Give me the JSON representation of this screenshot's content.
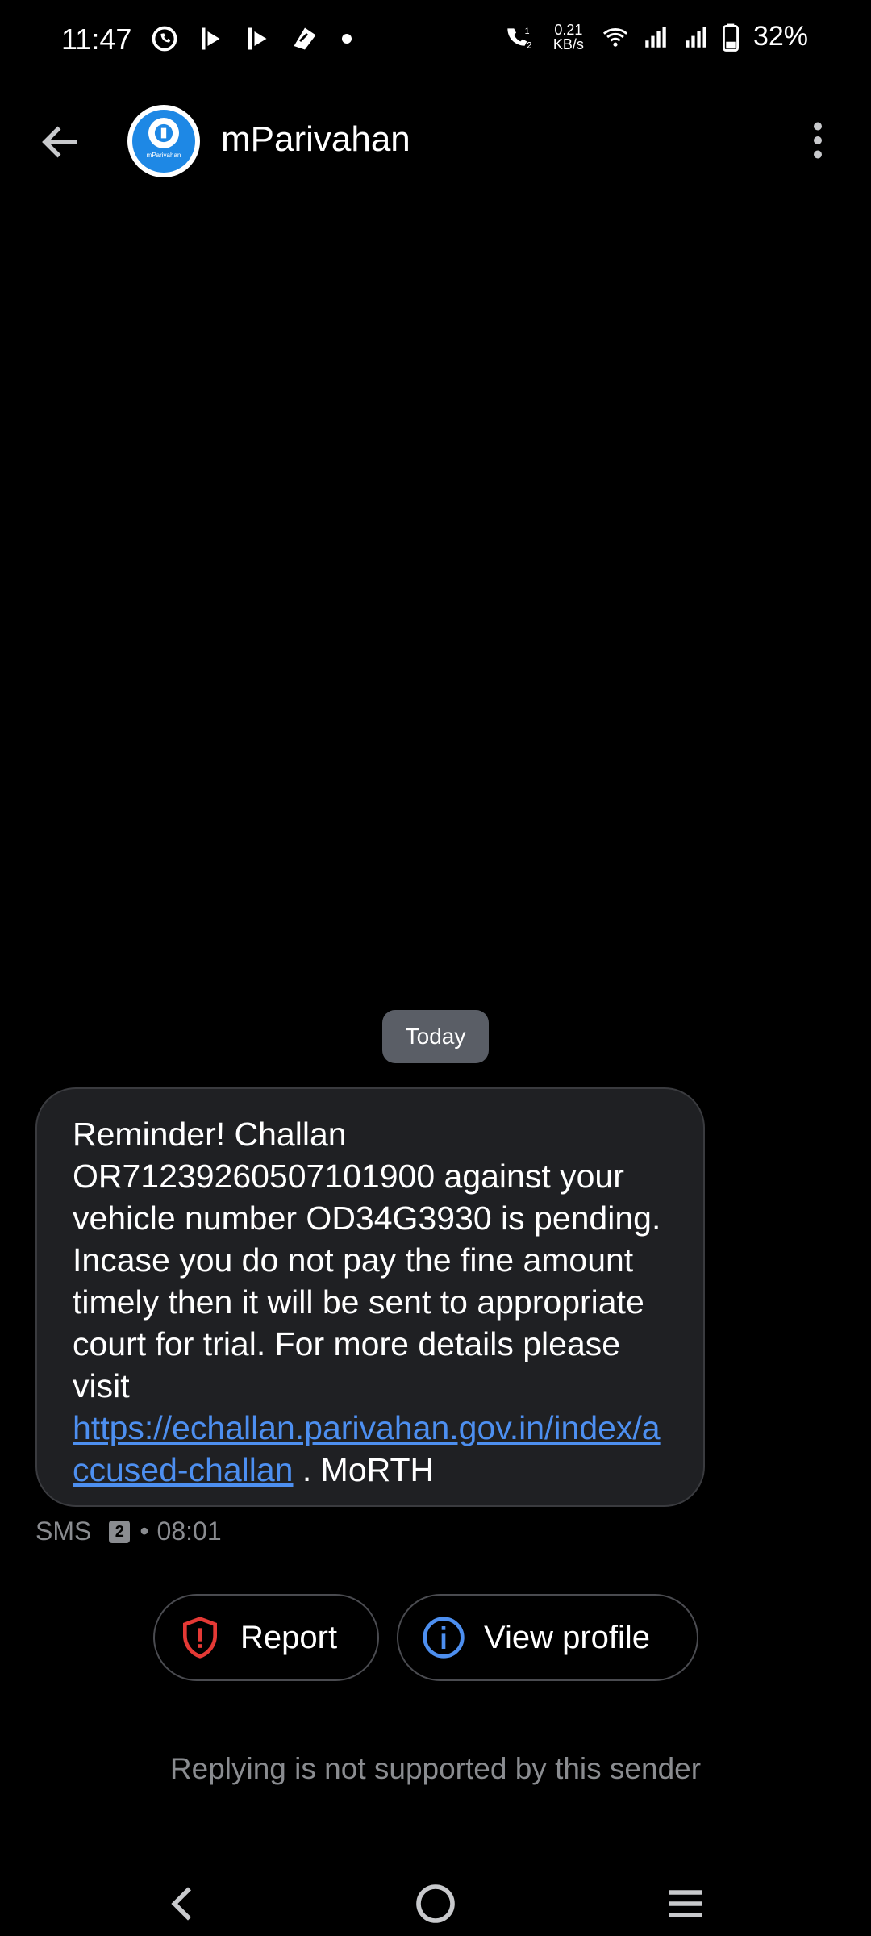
{
  "status_bar": {
    "time": "11:47",
    "net_speed_value": "0.21",
    "net_speed_unit": "KB/s",
    "battery_percent": "32%",
    "icons": [
      "whatsapp-icon",
      "media-icon",
      "media-icon",
      "app-icon",
      "dot",
      "call-icon",
      "wifi-icon",
      "signal-icon",
      "signal-icon",
      "battery-icon"
    ]
  },
  "header": {
    "contact_name": "mParivahan",
    "avatar_text": "mParivahan"
  },
  "conversation": {
    "date_chip": "Today",
    "message": {
      "text": "Reminder! Challan OR71239260507101900 against your vehicle number OD34G3930 is pending. Incase you do not pay the fine amount timely then it will be sent to appropriate court for trial. For more details please visit ",
      "link": "https://echallan.parivahan.gov.in/index/accused-challan",
      "suffix": " . MoRTH"
    },
    "meta": {
      "type": "SMS",
      "sim": "2",
      "separator": "•",
      "time": "08:01"
    }
  },
  "actions": {
    "report_label": "Report",
    "view_profile_label": "View profile"
  },
  "footer": {
    "reply_note": "Replying is not supported by this sender"
  },
  "colors": {
    "background": "#000000",
    "bubble": "#1f2023",
    "link": "#4d8ff0",
    "report_icon": "#e53935",
    "profile_icon": "#4d8ff0",
    "secondary_text": "#8a8c90"
  }
}
